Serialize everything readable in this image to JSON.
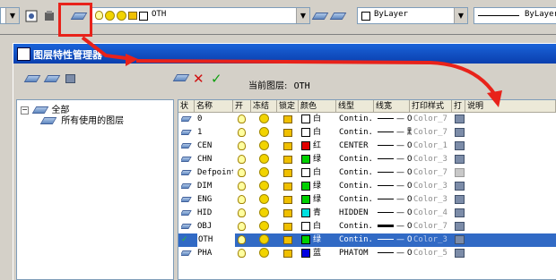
{
  "toolbar": {
    "layer_combo_text": "OTH",
    "color_combo_text": "ByLayer",
    "linetype_combo_text": "ByLayer"
  },
  "dialog": {
    "title": "图层特性管理器",
    "current_layer_label": "当前图层:",
    "current_layer_value": "OTH"
  },
  "tree": {
    "root": "全部",
    "child": "所有使用的图层"
  },
  "table": {
    "headers": [
      "状",
      "名称",
      "开",
      "冻结",
      "锁定",
      "颜色",
      "线型",
      "线宽",
      "打印样式",
      "打",
      "说明"
    ],
    "rows": [
      {
        "name": "0",
        "color_name": "白",
        "color": "#ffffff",
        "linetype": "Contin...",
        "lineweight": "— 0....",
        "plot_style": "Color_7",
        "current": false,
        "plot_disabled": false,
        "thick": false
      },
      {
        "name": "1",
        "color_name": "白",
        "color": "#ffffff",
        "linetype": "Contin...",
        "lineweight": "— 默认",
        "plot_style": "Color_7",
        "current": false,
        "plot_disabled": false,
        "thick": false
      },
      {
        "name": "CEN",
        "color_name": "红",
        "color": "#e00000",
        "linetype": "CENTER",
        "lineweight": "— 0....",
        "plot_style": "Color_1",
        "current": false,
        "plot_disabled": false,
        "thick": false
      },
      {
        "name": "CHN",
        "color_name": "绿",
        "color": "#00d000",
        "linetype": "Contin...",
        "lineweight": "— 0....",
        "plot_style": "Color_3",
        "current": false,
        "plot_disabled": false,
        "thick": false
      },
      {
        "name": "Defpoints",
        "color_name": "白",
        "color": "#ffffff",
        "linetype": "Contin...",
        "lineweight": "— 0....",
        "plot_style": "Color_7",
        "current": false,
        "plot_disabled": true,
        "thick": false
      },
      {
        "name": "DIM",
        "color_name": "绿",
        "color": "#00d000",
        "linetype": "Contin...",
        "lineweight": "— 0....",
        "plot_style": "Color_3",
        "current": false,
        "plot_disabled": false,
        "thick": false
      },
      {
        "name": "ENG",
        "color_name": "绿",
        "color": "#00d000",
        "linetype": "Contin...",
        "lineweight": "— 0....",
        "plot_style": "Color_3",
        "current": false,
        "plot_disabled": false,
        "thick": false
      },
      {
        "name": "HID",
        "color_name": "青",
        "color": "#00e0e0",
        "linetype": "HIDDEN",
        "lineweight": "— 0....",
        "plot_style": "Color_4",
        "current": false,
        "plot_disabled": false,
        "thick": false
      },
      {
        "name": "OBJ",
        "color_name": "白",
        "color": "#ffffff",
        "linetype": "Contin...",
        "lineweight": "— 0....",
        "plot_style": "Color_7",
        "current": false,
        "plot_disabled": false,
        "thick": true
      },
      {
        "name": "OTH",
        "color_name": "绿",
        "color": "#00d000",
        "linetype": "Contin...",
        "lineweight": "— 0....",
        "plot_style": "Color_3",
        "current": true,
        "plot_disabled": false,
        "thick": false
      },
      {
        "name": "PHA",
        "color_name": "蓝",
        "color": "#0000e0",
        "linetype": "PHATOM",
        "lineweight": "— 0....",
        "plot_style": "Color_5",
        "current": false,
        "plot_disabled": false,
        "thick": false
      }
    ]
  },
  "colors": {
    "selection": "#316ac5",
    "titlebar": "#0a3fae",
    "annotation_red": "#e8221a"
  }
}
